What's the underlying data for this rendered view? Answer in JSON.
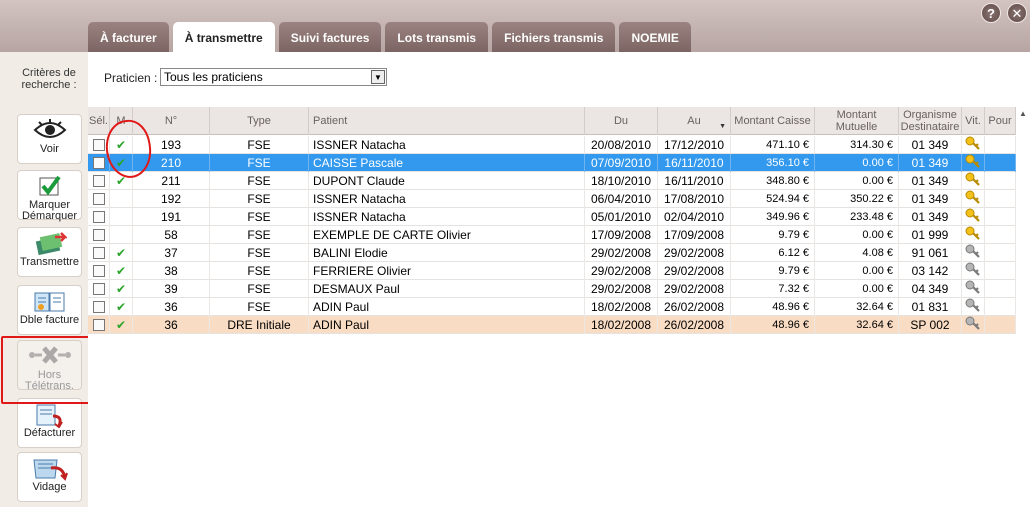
{
  "window": {
    "help_label": "?",
    "close_label": "✕"
  },
  "tabs": [
    {
      "label": "À facturer",
      "active": false
    },
    {
      "label": "À transmettre",
      "active": true
    },
    {
      "label": "Suivi factures",
      "active": false
    },
    {
      "label": "Lots transmis",
      "active": false
    },
    {
      "label": "Fichiers transmis",
      "active": false
    },
    {
      "label": "NOEMIE",
      "active": false
    }
  ],
  "sidebar": {
    "criteria_label": "Critères de recherche :",
    "buttons": [
      {
        "label": "Voir",
        "icon": "eye-icon"
      },
      {
        "label": "Marquer Démarquer",
        "icon": "checkmark-icon"
      },
      {
        "label": "Transmettre",
        "icon": "transmit-icon"
      },
      {
        "label": "Dble facture",
        "icon": "double-invoice-icon"
      },
      {
        "label": "Hors Télétrans.",
        "icon": "disconnect-icon",
        "disabled": true
      },
      {
        "label": "Défacturer",
        "icon": "uninvoice-icon"
      },
      {
        "label": "Vidage",
        "icon": "empty-icon"
      }
    ]
  },
  "filter": {
    "label": "Praticien :",
    "value": "Tous les praticiens"
  },
  "table": {
    "columns": [
      "Sél.",
      "M",
      "N°",
      "Type",
      "Patient",
      "Du",
      "Au",
      "Montant Caisse",
      "Montant Mutuelle",
      "Organisme Destinataire",
      "Vit.",
      "Pour"
    ],
    "rows": [
      {
        "marked": true,
        "num": "193",
        "type": "FSE",
        "patient": "ISSNER Natacha",
        "du": "20/08/2010",
        "au": "17/12/2010",
        "caisse": "471.10 €",
        "mutuelle": "314.30 €",
        "org": "01  349",
        "vit": "gold",
        "state": ""
      },
      {
        "marked": true,
        "num": "210",
        "type": "FSE",
        "patient": "CAISSE Pascale",
        "du": "07/09/2010",
        "au": "16/11/2010",
        "caisse": "356.10 €",
        "mutuelle": "0.00 €",
        "org": "01  349",
        "vit": "gold",
        "state": "selected"
      },
      {
        "marked": true,
        "num": "211",
        "type": "FSE",
        "patient": "DUPONT Claude",
        "du": "18/10/2010",
        "au": "16/11/2010",
        "caisse": "348.80 €",
        "mutuelle": "0.00 €",
        "org": "01  349",
        "vit": "gold",
        "state": ""
      },
      {
        "marked": false,
        "num": "192",
        "type": "FSE",
        "patient": "ISSNER Natacha",
        "du": "06/04/2010",
        "au": "17/08/2010",
        "caisse": "524.94 €",
        "mutuelle": "350.22 €",
        "org": "01  349",
        "vit": "gold",
        "state": ""
      },
      {
        "marked": false,
        "num": "191",
        "type": "FSE",
        "patient": "ISSNER Natacha",
        "du": "05/01/2010",
        "au": "02/04/2010",
        "caisse": "349.96 €",
        "mutuelle": "233.48 €",
        "org": "01  349",
        "vit": "gold",
        "state": ""
      },
      {
        "marked": false,
        "num": "58",
        "type": "FSE",
        "patient": "EXEMPLE DE CARTE Olivier",
        "du": "17/09/2008",
        "au": "17/09/2008",
        "caisse": "9.79 €",
        "mutuelle": "0.00 €",
        "org": "01  999",
        "vit": "gold",
        "state": ""
      },
      {
        "marked": true,
        "num": "37",
        "type": "FSE",
        "patient": "BALINI Elodie",
        "du": "29/02/2008",
        "au": "29/02/2008",
        "caisse": "6.12 €",
        "mutuelle": "4.08 €",
        "org": "91  061",
        "vit": "grey",
        "state": ""
      },
      {
        "marked": true,
        "num": "38",
        "type": "FSE",
        "patient": "FERRIERE Olivier",
        "du": "29/02/2008",
        "au": "29/02/2008",
        "caisse": "9.79 €",
        "mutuelle": "0.00 €",
        "org": "03  142",
        "vit": "grey",
        "state": ""
      },
      {
        "marked": true,
        "num": "39",
        "type": "FSE",
        "patient": "DESMAUX Paul",
        "du": "29/02/2008",
        "au": "29/02/2008",
        "caisse": "7.32 €",
        "mutuelle": "0.00 €",
        "org": "04  349",
        "vit": "grey",
        "state": ""
      },
      {
        "marked": true,
        "num": "36",
        "type": "FSE",
        "patient": "ADIN Paul",
        "du": "18/02/2008",
        "au": "26/02/2008",
        "caisse": "48.96 €",
        "mutuelle": "32.64 €",
        "org": "01  831",
        "vit": "grey",
        "state": ""
      },
      {
        "marked": true,
        "num": "36",
        "type": "DRE Initiale",
        "patient": "ADIN Paul",
        "du": "18/02/2008",
        "au": "26/02/2008",
        "caisse": "48.96 €",
        "mutuelle": "32.64 €",
        "org": "SP  002",
        "vit": "grey",
        "state": "peach"
      }
    ]
  },
  "colors": {
    "selected_row": "#3399ee",
    "peach_row": "#f9dcc4",
    "tick": "#2aa52a",
    "annotation": "#e01818"
  }
}
